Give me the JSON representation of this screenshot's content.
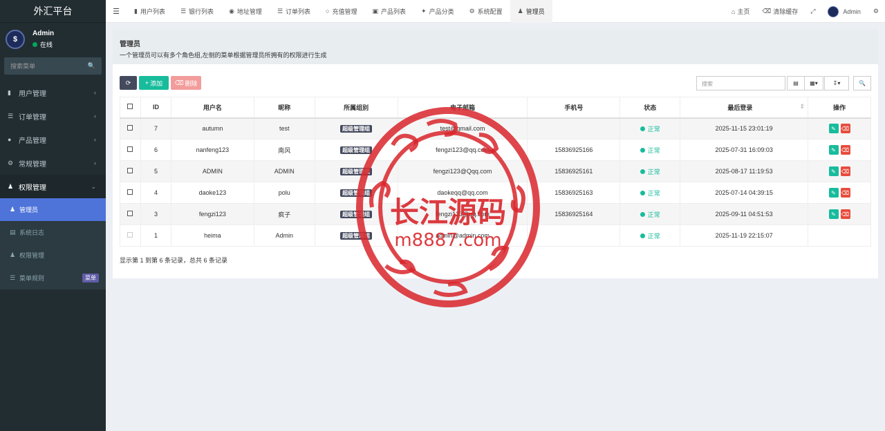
{
  "brand": "外汇平台",
  "user": {
    "name": "Admin",
    "status": "在线"
  },
  "side_search": {
    "placeholder": "搜索菜单"
  },
  "menu": [
    {
      "label": "用户管理",
      "icon": "user-card-icon"
    },
    {
      "label": "订单管理",
      "icon": "list-icon"
    },
    {
      "label": "产品管理",
      "icon": "product-icon"
    },
    {
      "label": "常规管理",
      "icon": "cogs-icon"
    }
  ],
  "menu_open": {
    "label": "权限管理",
    "icon": "group-icon"
  },
  "submenu": [
    {
      "label": "管理员",
      "icon": "user-icon",
      "active": true
    },
    {
      "label": "系统日志",
      "icon": "log-icon"
    },
    {
      "label": "权限管理",
      "icon": "group-icon"
    },
    {
      "label": "菜单规则",
      "icon": "bars-icon",
      "badge": "菜单"
    }
  ],
  "tabs": [
    {
      "label": "用户列表",
      "icon": "user-card-icon"
    },
    {
      "label": "银行列表",
      "icon": "database-icon"
    },
    {
      "label": "地址管理",
      "icon": "address-icon"
    },
    {
      "label": "订单列表",
      "icon": "list-icon"
    },
    {
      "label": "充值管理",
      "icon": "recharge-icon"
    },
    {
      "label": "产品列表",
      "icon": "product-list-icon"
    },
    {
      "label": "产品分类",
      "icon": "category-icon"
    },
    {
      "label": "系统配置",
      "icon": "gear-icon"
    },
    {
      "label": "管理员",
      "icon": "user-icon"
    }
  ],
  "topright": {
    "home": "主页",
    "clear_cache": "清除缓存",
    "admin": "Admin"
  },
  "page": {
    "title": "管理员",
    "desc": "一个管理员可以有多个角色组,左侧的菜单根据管理员所拥有的权限进行生成"
  },
  "toolbar": {
    "add": "添加",
    "delete": "删除",
    "search_placeholder": "搜索"
  },
  "table": {
    "headers": [
      "ID",
      "用户名",
      "昵称",
      "所属组别",
      "电子邮箱",
      "手机号",
      "状态",
      "最后登录",
      "操作"
    ],
    "rows": [
      {
        "id": "7",
        "username": "autumn",
        "nickname": "test",
        "group": "超级管理组",
        "email": "test@gmail.com",
        "phone": "",
        "status": "正常",
        "last_login": "2025-11-15 23:01:19"
      },
      {
        "id": "6",
        "username": "nanfeng123",
        "nickname": "南风",
        "group": "超级管理组",
        "email": "fengzi123@qq.com",
        "phone": "15836925166",
        "status": "正常",
        "last_login": "2025-07-31 16:09:03"
      },
      {
        "id": "5",
        "username": "ADMIN",
        "nickname": "ADMIN",
        "group": "超级管理组",
        "email": "fengzi123@Qqq.com",
        "phone": "15836925161",
        "status": "正常",
        "last_login": "2025-08-17 11:19:53"
      },
      {
        "id": "4",
        "username": "daoke123",
        "nickname": "polu",
        "group": "超级管理组",
        "email": "daokeqq@qq.com",
        "phone": "15836925163",
        "status": "正常",
        "last_login": "2025-07-14 04:39:15"
      },
      {
        "id": "3",
        "username": "fengzi123",
        "nickname": "疯子",
        "group": "超级管理组",
        "email": "fengzi123@qq.com",
        "phone": "15836925164",
        "status": "正常",
        "last_login": "2025-09-11 04:51:53"
      },
      {
        "id": "1",
        "username": "heima",
        "nickname": "Admin",
        "group": "超级管理组",
        "email": "admin@admin.com",
        "phone": "",
        "status": "正常",
        "last_login": "2025-11-19 22:15:07"
      }
    ]
  },
  "pager": "显示第 1 到第 6 条记录，总共 6 条记录",
  "watermark": {
    "line1": "长江源码",
    "line2": "m8887.com",
    "color": "#d9262c"
  }
}
